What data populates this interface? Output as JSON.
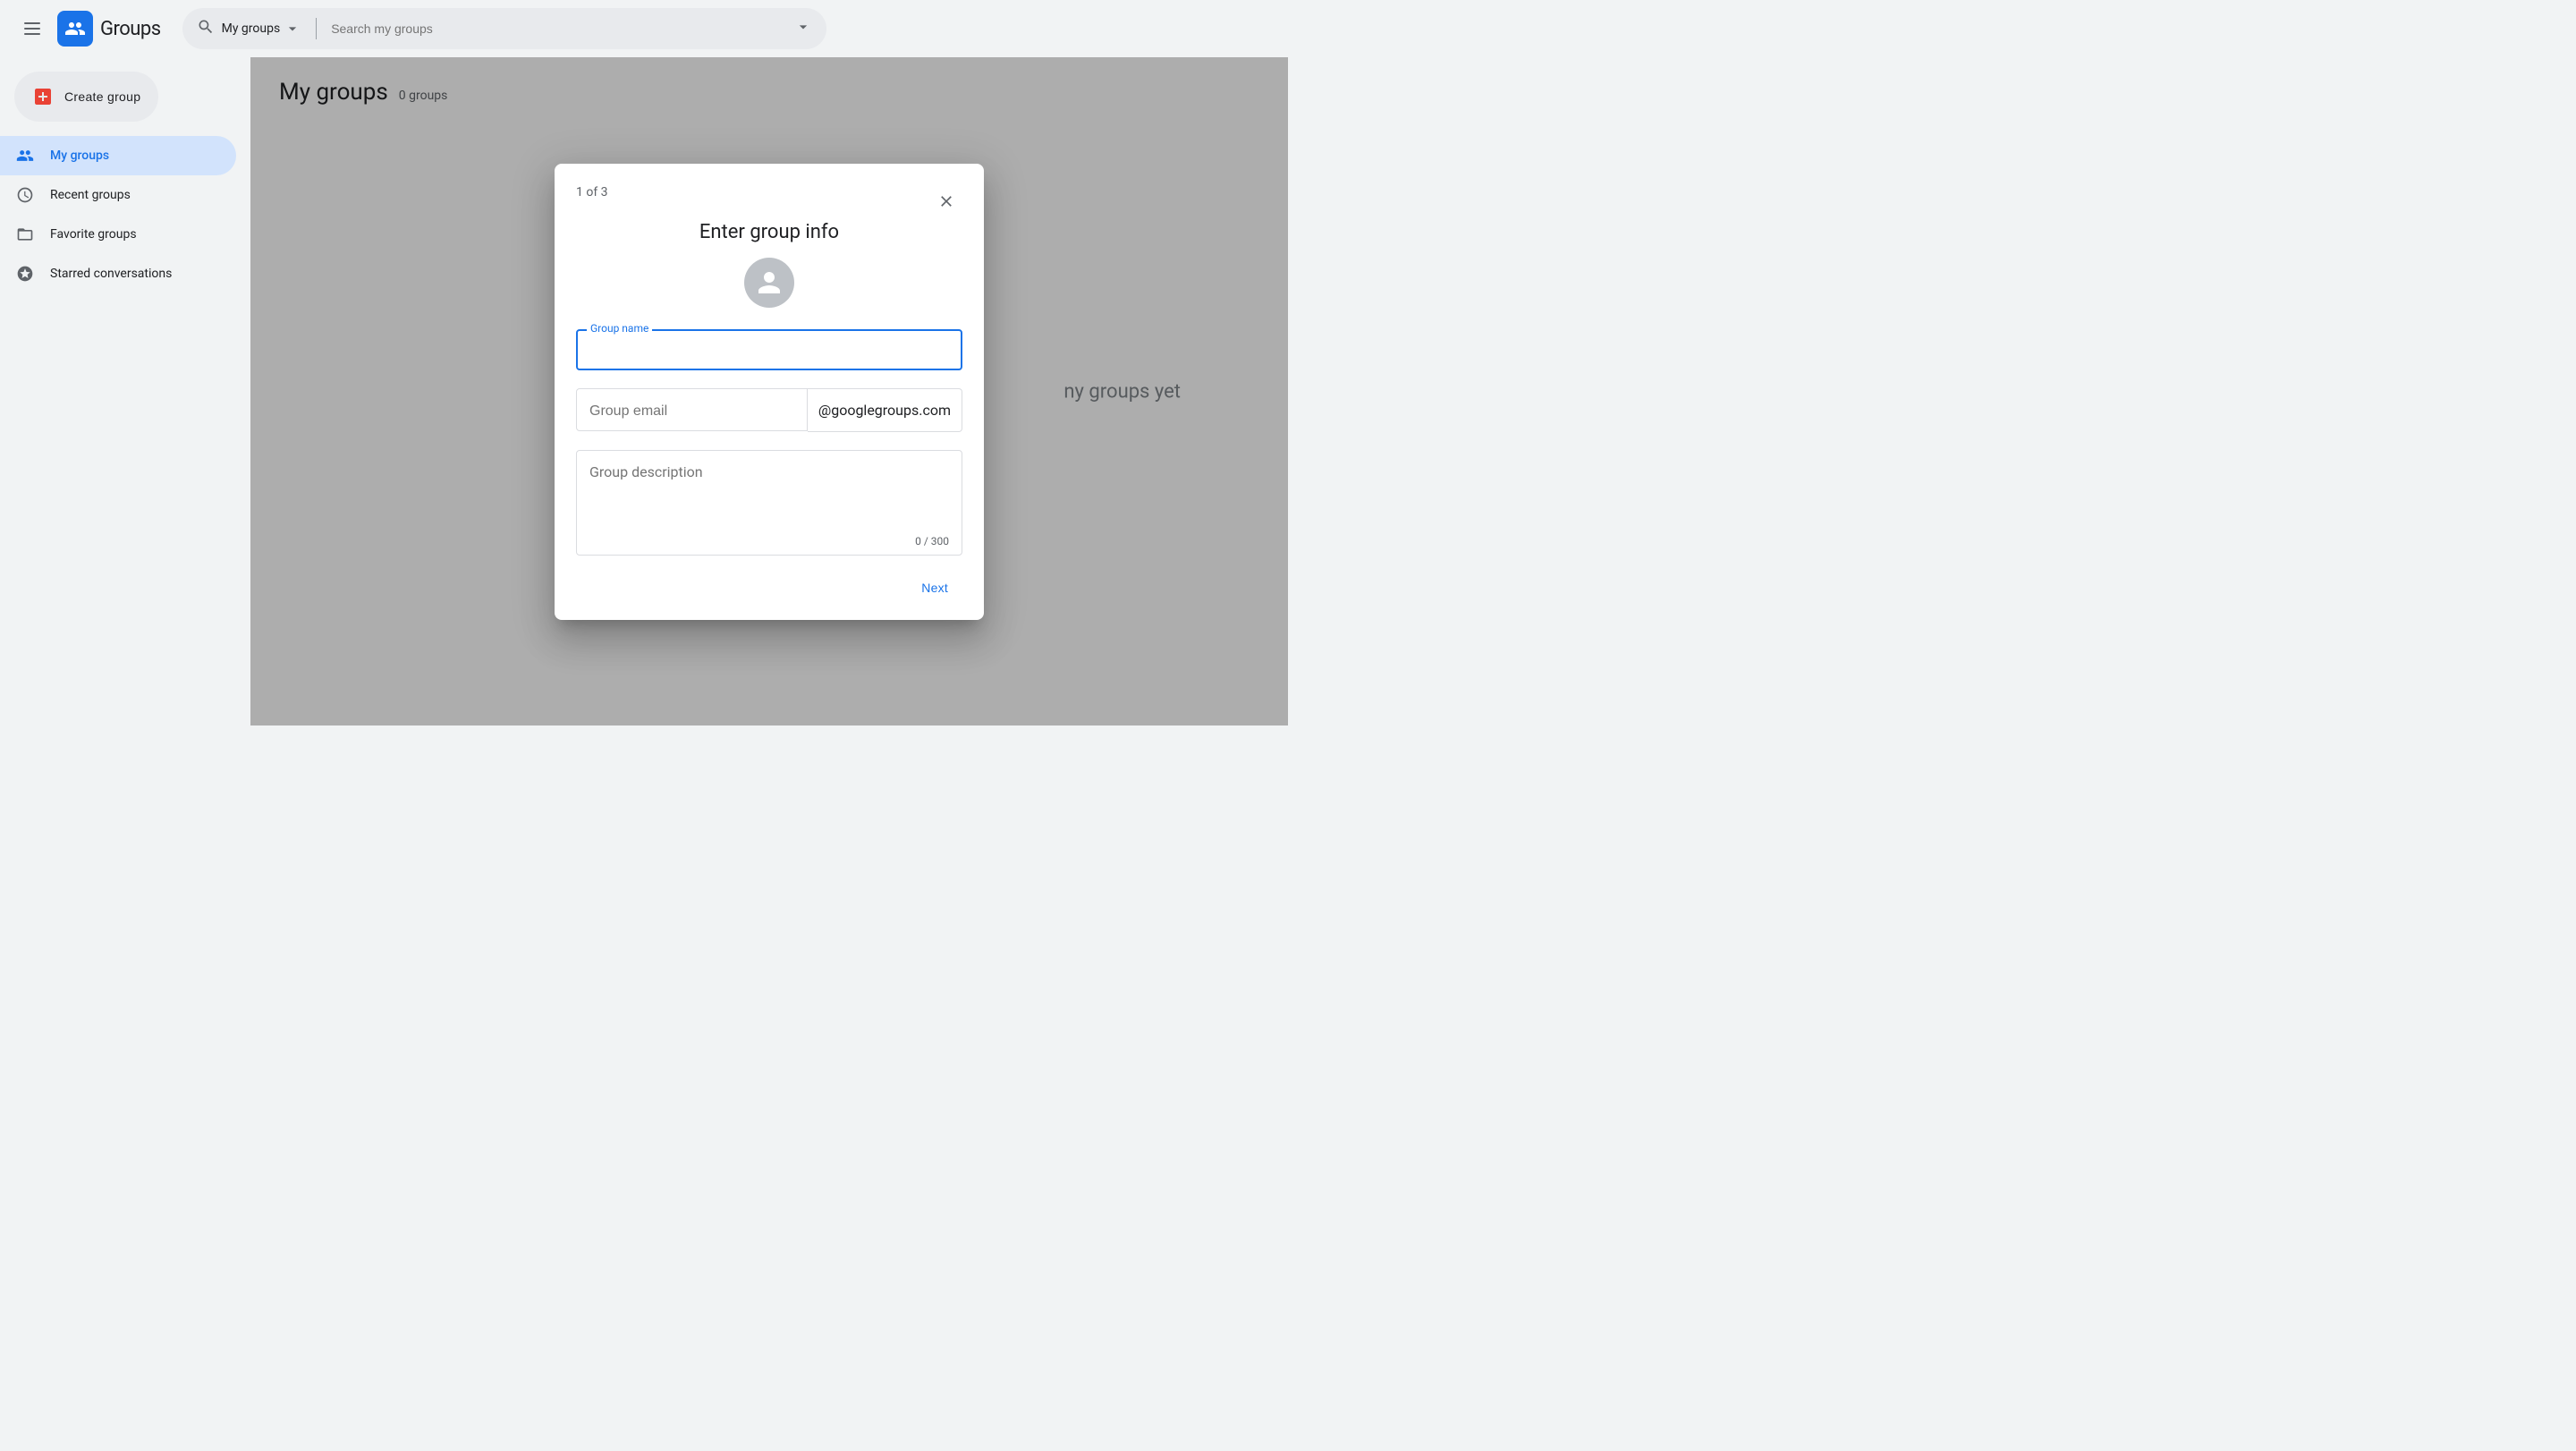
{
  "app": {
    "title": "Groups",
    "logo_alt": "Google Groups"
  },
  "topbar": {
    "search_scope": "My groups",
    "search_placeholder": "Search my groups"
  },
  "sidebar": {
    "create_group_label": "Create group",
    "items": [
      {
        "id": "my-groups",
        "label": "My groups",
        "icon": "people-icon",
        "active": true
      },
      {
        "id": "recent-groups",
        "label": "Recent groups",
        "icon": "clock-icon",
        "active": false
      },
      {
        "id": "favorite-groups",
        "label": "Favorite groups",
        "icon": "folder-icon",
        "active": false
      },
      {
        "id": "starred-conversations",
        "label": "Starred conversations",
        "icon": "star-icon",
        "active": false
      }
    ]
  },
  "main": {
    "page_title": "My groups",
    "groups_count": "0 groups",
    "empty_state": "ny groups yet"
  },
  "dialog": {
    "step": "1 of 3",
    "title": "Enter group info",
    "group_name_label": "Group name",
    "group_name_value": "",
    "group_email_placeholder": "Group email",
    "email_domain": "@googlegroups.com",
    "group_description_placeholder": "Group description",
    "char_count": "0 / 300",
    "next_label": "Next",
    "close_label": "Close"
  }
}
